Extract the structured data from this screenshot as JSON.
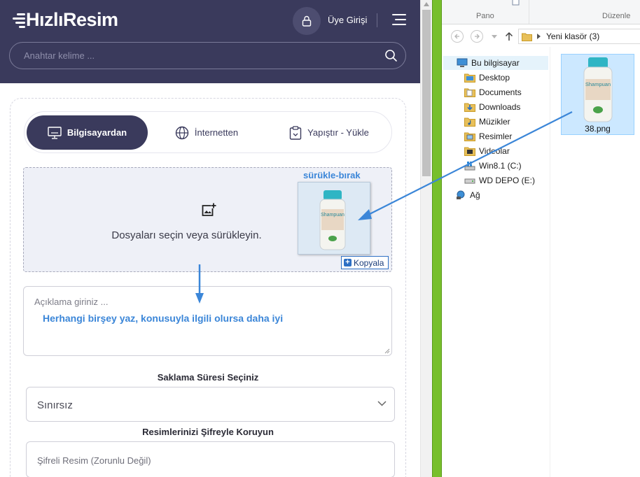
{
  "site": {
    "logo_text": "HızlıResim",
    "login_label": "Üye Girişi",
    "search_placeholder": "Anahtar kelime ..."
  },
  "upload_tabs": [
    {
      "label": "Bilgisayardan",
      "active": true,
      "icon": "desktop-icon"
    },
    {
      "label": "İnternetten",
      "active": false,
      "icon": "globe-icon"
    },
    {
      "label": "Yapıştır - Yükle",
      "active": false,
      "icon": "clipboard-icon"
    }
  ],
  "dropzone": {
    "text": "Dosyaları seçin veya sürükleyin.",
    "icon": "add-image-icon"
  },
  "annotations": {
    "drag_label": "sürükle-bırak",
    "copy_label": "Kopyala",
    "description_hint": "Herhangi birşey yaz, konusuyla ilgili olursa daha iyi"
  },
  "description": {
    "placeholder": "Açıklama giriniz ..."
  },
  "storage": {
    "label": "Saklama Süresi Seçiniz",
    "selected": "Sınırsız"
  },
  "password": {
    "label": "Resimlerinizi Şifreyle Koruyun",
    "placeholder": "Şifreli Resim (Zorunlu Değil)"
  },
  "explorer": {
    "ribbon_groups": [
      "Pano",
      "Düzenle"
    ],
    "address": "Yeni klasör (3)",
    "tree": [
      {
        "label": "Bu bilgisayar",
        "icon": "computer-icon",
        "selected": true
      },
      {
        "label": "Desktop",
        "icon": "folder-icon"
      },
      {
        "label": "Documents",
        "icon": "folder-icon"
      },
      {
        "label": "Downloads",
        "icon": "download-folder-icon"
      },
      {
        "label": "Müzikler",
        "icon": "music-folder-icon"
      },
      {
        "label": "Resimler",
        "icon": "pictures-folder-icon"
      },
      {
        "label": "Videolar",
        "icon": "video-folder-icon"
      },
      {
        "label": "Win8.1 (C:)",
        "icon": "windows-drive-icon"
      },
      {
        "label": "WD DEPO (E:)",
        "icon": "drive-icon"
      },
      {
        "label": "Ağ",
        "icon": "network-icon"
      }
    ],
    "file": {
      "name": "38.png",
      "selected": true
    }
  },
  "colors": {
    "header_bg": "#3a3a5c",
    "annotation_blue": "#3b86d8",
    "explorer_select": "#cce8ff",
    "window_border_green": "#77bf2c"
  }
}
